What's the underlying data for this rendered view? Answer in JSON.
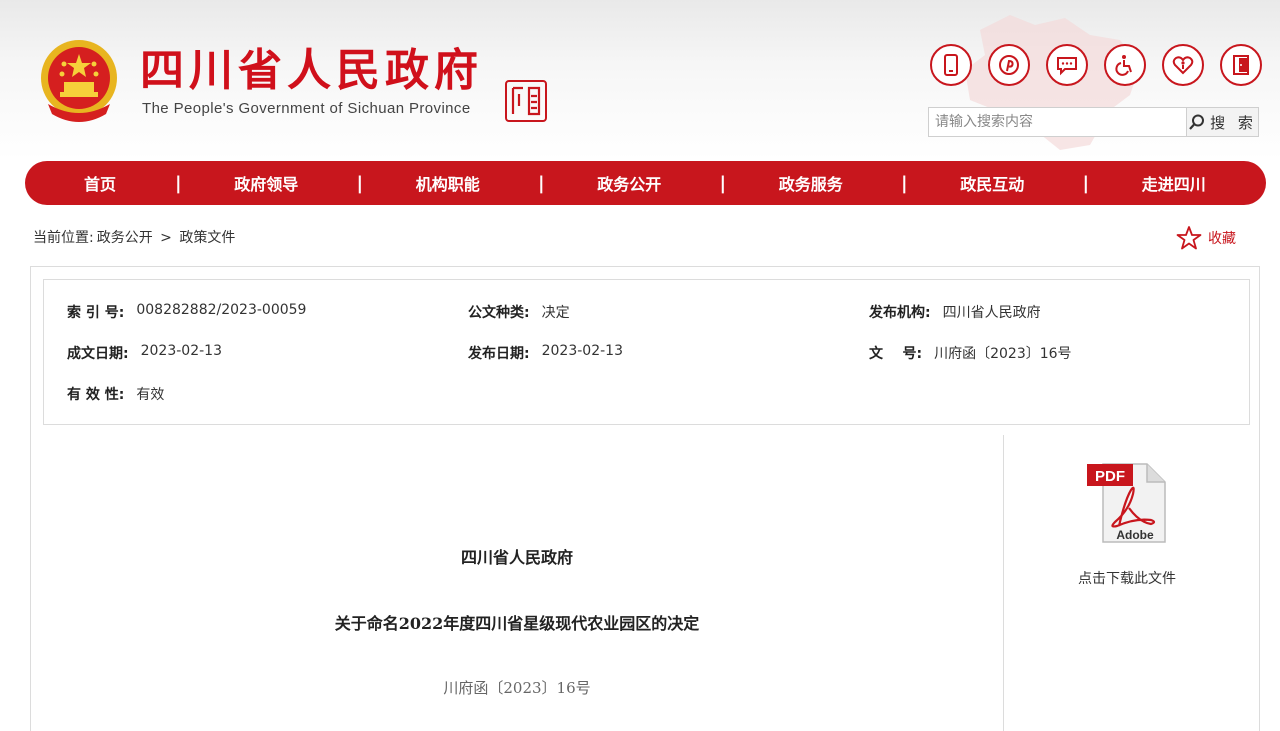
{
  "header": {
    "title": "四川省人民政府",
    "subtitle": "The People's Government of Sichuan Province",
    "brand_color": "#c8161d"
  },
  "quick_icons": [
    {
      "name": "mobile-icon"
    },
    {
      "name": "pinterest-style-p-icon"
    },
    {
      "name": "chat-bubble-icon"
    },
    {
      "name": "accessibility-wheelchair-icon"
    },
    {
      "name": "elderly-care-icon"
    },
    {
      "name": "exit-door-icon"
    }
  ],
  "search": {
    "placeholder": "请输入搜索内容",
    "button_label": "搜 索"
  },
  "nav": {
    "items": [
      "首页",
      "政府领导",
      "机构职能",
      "政务公开",
      "政务服务",
      "政民互动",
      "走进四川"
    ]
  },
  "breadcrumb": {
    "prefix": "当前位置:",
    "level1": "政务公开",
    "separator": ">",
    "level2": "政策文件"
  },
  "favorite_label": "收藏",
  "meta": {
    "index_label": "索 引 号:",
    "index_value": "008282882/2023-00059",
    "type_label": "公文种类:",
    "type_value": "决定",
    "publisher_label": "发布机构:",
    "publisher_value": "四川省人民政府",
    "written_date_label": "成文日期:",
    "written_date_value": "2023-02-13",
    "publish_date_label": "发布日期:",
    "publish_date_value": "2023-02-13",
    "docno_label": "文    号:",
    "docno_value": "川府函〔2023〕16号",
    "validity_label": "有 效 性:",
    "validity_value": "有效"
  },
  "document": {
    "issuer": "四川省人民政府",
    "title": "关于命名2022年度四川省星级现代农业园区的决定",
    "number": "川府函〔2023〕16号"
  },
  "download": {
    "pdf_badge": "PDF",
    "adobe_text": "Adobe",
    "caption": "点击下载此文件"
  }
}
